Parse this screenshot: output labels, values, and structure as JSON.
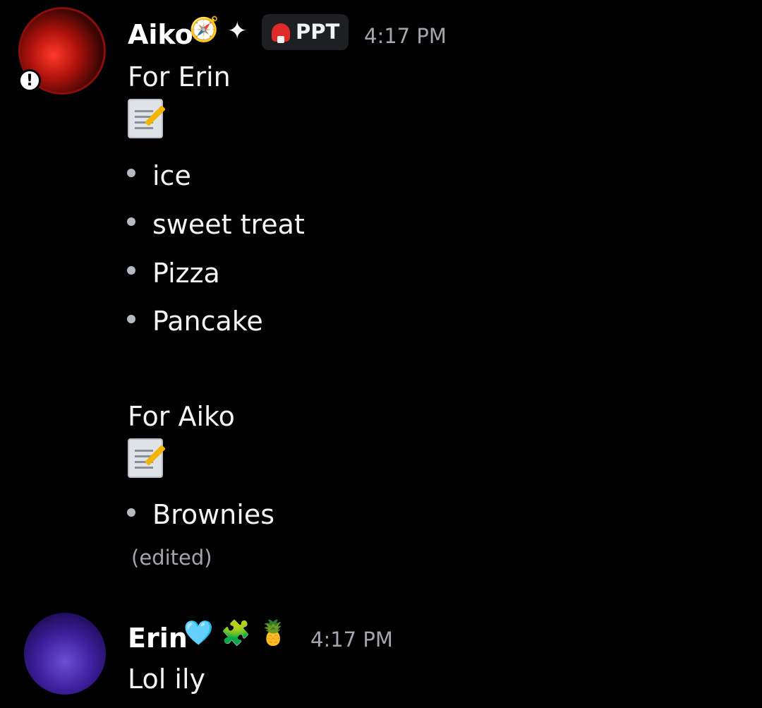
{
  "messages": [
    {
      "author": "Aiko",
      "author_emojis": [
        "compass-emoji",
        "sparkle-emoji"
      ],
      "tag": {
        "icon": "mushroom-icon",
        "label": "PPT"
      },
      "timestamp": "4:17 PM",
      "lines": {
        "heading1": "For Erin",
        "memo1": "memo-emoji",
        "list1": [
          "ice",
          "sweet treat",
          "Pizza",
          "Pancake"
        ],
        "heading2": "For Aiko",
        "memo2": "memo-emoji",
        "list2": [
          "Brownies"
        ]
      },
      "edited": "(edited)"
    },
    {
      "author": "Erin",
      "author_emojis": [
        "light-blue-heart-emoji",
        "puzzle-piece-emoji",
        "pineapple-emoji"
      ],
      "timestamp": "4:17 PM",
      "text": "Lol ily"
    }
  ],
  "colors": {
    "background": "#000000",
    "text": "#f2f3f5",
    "muted": "#a3a6ad",
    "tag_background": "#1e1f22"
  }
}
